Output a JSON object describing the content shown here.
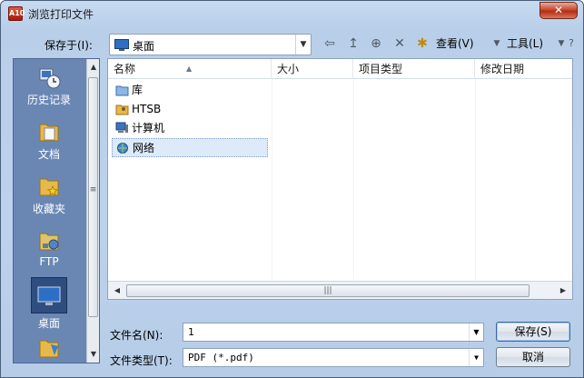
{
  "window": {
    "title": "浏览打印文件",
    "app_icon_text": "A10",
    "close_symbol": "✕"
  },
  "toolbar": {
    "save_in_label": "保存于(I):",
    "location": "桌面",
    "back_icon": "⇦",
    "up_icon": "↥",
    "search_icon": "⊕",
    "delete_icon": "✕",
    "new_folder_icon": "✱",
    "view_label": "查看(V)",
    "tools_label": "工具(L)",
    "help_icon": "?"
  },
  "places": [
    {
      "label": "历史记录"
    },
    {
      "label": "文档"
    },
    {
      "label": "收藏夹"
    },
    {
      "label": "FTP"
    },
    {
      "label": "桌面"
    }
  ],
  "file_list": {
    "columns": [
      "名称",
      "大小",
      "项目类型",
      "修改日期"
    ],
    "rows": [
      {
        "name": "库"
      },
      {
        "name": "HTSB"
      },
      {
        "name": "计算机"
      },
      {
        "name": "网络"
      }
    ]
  },
  "file_name": {
    "label": "文件名(N):",
    "value": "1"
  },
  "file_type": {
    "label": "文件类型(T):",
    "value": "PDF (*.pdf)"
  },
  "buttons": {
    "save": "保存(S)",
    "cancel": "取消"
  }
}
